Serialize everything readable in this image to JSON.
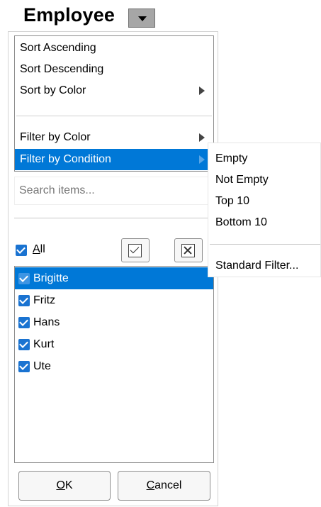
{
  "header": {
    "title": "Employee"
  },
  "menu": {
    "items": [
      {
        "label": "Sort Ascending",
        "has_submenu": false
      },
      {
        "label": "Sort Descending",
        "has_submenu": false
      },
      {
        "label": "Sort by Color",
        "has_submenu": true
      },
      {
        "label": "Filter by Color",
        "has_submenu": true
      },
      {
        "label": "Filter by Condition",
        "has_submenu": true,
        "selected": true
      }
    ]
  },
  "search": {
    "placeholder": "Search items..."
  },
  "all": {
    "label_underlined": "A",
    "label_rest": "ll",
    "checked": true
  },
  "list": {
    "items": [
      {
        "label": "Brigitte",
        "checked": true,
        "selected": true
      },
      {
        "label": "Fritz",
        "checked": true
      },
      {
        "label": "Hans",
        "checked": true
      },
      {
        "label": "Kurt",
        "checked": true
      },
      {
        "label": "Ute",
        "checked": true
      }
    ]
  },
  "buttons": {
    "ok_underlined": "O",
    "ok_rest": "K",
    "cancel_underlined": "C",
    "cancel_rest": "ancel"
  },
  "submenu": {
    "items": [
      "Empty",
      "Not Empty",
      "Top 10",
      "Bottom 10",
      "Standard Filter..."
    ]
  },
  "colors": {
    "accent": "#0078d7",
    "checkbox": "#1a73d1",
    "dropdown_button": "#a6a6a6"
  },
  "icons": [
    "dropdown-arrow-icon",
    "submenu-arrow-icon",
    "checkbox-icon",
    "check-all-icon",
    "uncheck-all-icon"
  ]
}
